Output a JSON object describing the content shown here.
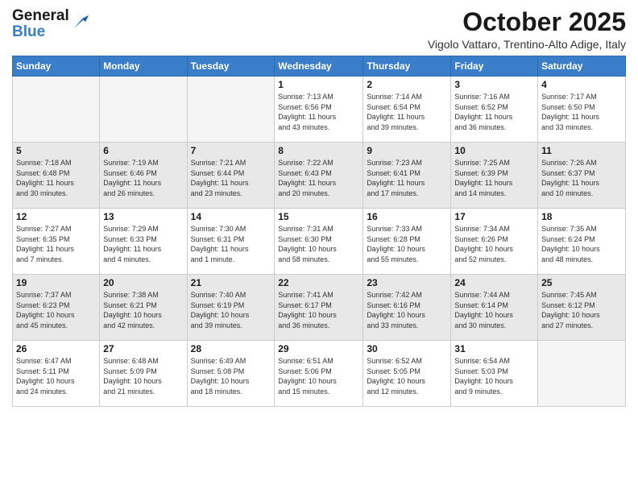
{
  "header": {
    "logo_line1": "General",
    "logo_line2": "Blue",
    "month_title": "October 2025",
    "subtitle": "Vigolo Vattaro, Trentino-Alto Adige, Italy"
  },
  "days_of_week": [
    "Sunday",
    "Monday",
    "Tuesday",
    "Wednesday",
    "Thursday",
    "Friday",
    "Saturday"
  ],
  "weeks": [
    [
      {
        "day": "",
        "info": ""
      },
      {
        "day": "",
        "info": ""
      },
      {
        "day": "",
        "info": ""
      },
      {
        "day": "1",
        "info": "Sunrise: 7:13 AM\nSunset: 6:56 PM\nDaylight: 11 hours\nand 43 minutes."
      },
      {
        "day": "2",
        "info": "Sunrise: 7:14 AM\nSunset: 6:54 PM\nDaylight: 11 hours\nand 39 minutes."
      },
      {
        "day": "3",
        "info": "Sunrise: 7:16 AM\nSunset: 6:52 PM\nDaylight: 11 hours\nand 36 minutes."
      },
      {
        "day": "4",
        "info": "Sunrise: 7:17 AM\nSunset: 6:50 PM\nDaylight: 11 hours\nand 33 minutes."
      }
    ],
    [
      {
        "day": "5",
        "info": "Sunrise: 7:18 AM\nSunset: 6:48 PM\nDaylight: 11 hours\nand 30 minutes."
      },
      {
        "day": "6",
        "info": "Sunrise: 7:19 AM\nSunset: 6:46 PM\nDaylight: 11 hours\nand 26 minutes."
      },
      {
        "day": "7",
        "info": "Sunrise: 7:21 AM\nSunset: 6:44 PM\nDaylight: 11 hours\nand 23 minutes."
      },
      {
        "day": "8",
        "info": "Sunrise: 7:22 AM\nSunset: 6:43 PM\nDaylight: 11 hours\nand 20 minutes."
      },
      {
        "day": "9",
        "info": "Sunrise: 7:23 AM\nSunset: 6:41 PM\nDaylight: 11 hours\nand 17 minutes."
      },
      {
        "day": "10",
        "info": "Sunrise: 7:25 AM\nSunset: 6:39 PM\nDaylight: 11 hours\nand 14 minutes."
      },
      {
        "day": "11",
        "info": "Sunrise: 7:26 AM\nSunset: 6:37 PM\nDaylight: 11 hours\nand 10 minutes."
      }
    ],
    [
      {
        "day": "12",
        "info": "Sunrise: 7:27 AM\nSunset: 6:35 PM\nDaylight: 11 hours\nand 7 minutes."
      },
      {
        "day": "13",
        "info": "Sunrise: 7:29 AM\nSunset: 6:33 PM\nDaylight: 11 hours\nand 4 minutes."
      },
      {
        "day": "14",
        "info": "Sunrise: 7:30 AM\nSunset: 6:31 PM\nDaylight: 11 hours\nand 1 minute."
      },
      {
        "day": "15",
        "info": "Sunrise: 7:31 AM\nSunset: 6:30 PM\nDaylight: 10 hours\nand 58 minutes."
      },
      {
        "day": "16",
        "info": "Sunrise: 7:33 AM\nSunset: 6:28 PM\nDaylight: 10 hours\nand 55 minutes."
      },
      {
        "day": "17",
        "info": "Sunrise: 7:34 AM\nSunset: 6:26 PM\nDaylight: 10 hours\nand 52 minutes."
      },
      {
        "day": "18",
        "info": "Sunrise: 7:35 AM\nSunset: 6:24 PM\nDaylight: 10 hours\nand 48 minutes."
      }
    ],
    [
      {
        "day": "19",
        "info": "Sunrise: 7:37 AM\nSunset: 6:23 PM\nDaylight: 10 hours\nand 45 minutes."
      },
      {
        "day": "20",
        "info": "Sunrise: 7:38 AM\nSunset: 6:21 PM\nDaylight: 10 hours\nand 42 minutes."
      },
      {
        "day": "21",
        "info": "Sunrise: 7:40 AM\nSunset: 6:19 PM\nDaylight: 10 hours\nand 39 minutes."
      },
      {
        "day": "22",
        "info": "Sunrise: 7:41 AM\nSunset: 6:17 PM\nDaylight: 10 hours\nand 36 minutes."
      },
      {
        "day": "23",
        "info": "Sunrise: 7:42 AM\nSunset: 6:16 PM\nDaylight: 10 hours\nand 33 minutes."
      },
      {
        "day": "24",
        "info": "Sunrise: 7:44 AM\nSunset: 6:14 PM\nDaylight: 10 hours\nand 30 minutes."
      },
      {
        "day": "25",
        "info": "Sunrise: 7:45 AM\nSunset: 6:12 PM\nDaylight: 10 hours\nand 27 minutes."
      }
    ],
    [
      {
        "day": "26",
        "info": "Sunrise: 6:47 AM\nSunset: 5:11 PM\nDaylight: 10 hours\nand 24 minutes."
      },
      {
        "day": "27",
        "info": "Sunrise: 6:48 AM\nSunset: 5:09 PM\nDaylight: 10 hours\nand 21 minutes."
      },
      {
        "day": "28",
        "info": "Sunrise: 6:49 AM\nSunset: 5:08 PM\nDaylight: 10 hours\nand 18 minutes."
      },
      {
        "day": "29",
        "info": "Sunrise: 6:51 AM\nSunset: 5:06 PM\nDaylight: 10 hours\nand 15 minutes."
      },
      {
        "day": "30",
        "info": "Sunrise: 6:52 AM\nSunset: 5:05 PM\nDaylight: 10 hours\nand 12 minutes."
      },
      {
        "day": "31",
        "info": "Sunrise: 6:54 AM\nSunset: 5:03 PM\nDaylight: 10 hours\nand 9 minutes."
      },
      {
        "day": "",
        "info": ""
      }
    ]
  ]
}
